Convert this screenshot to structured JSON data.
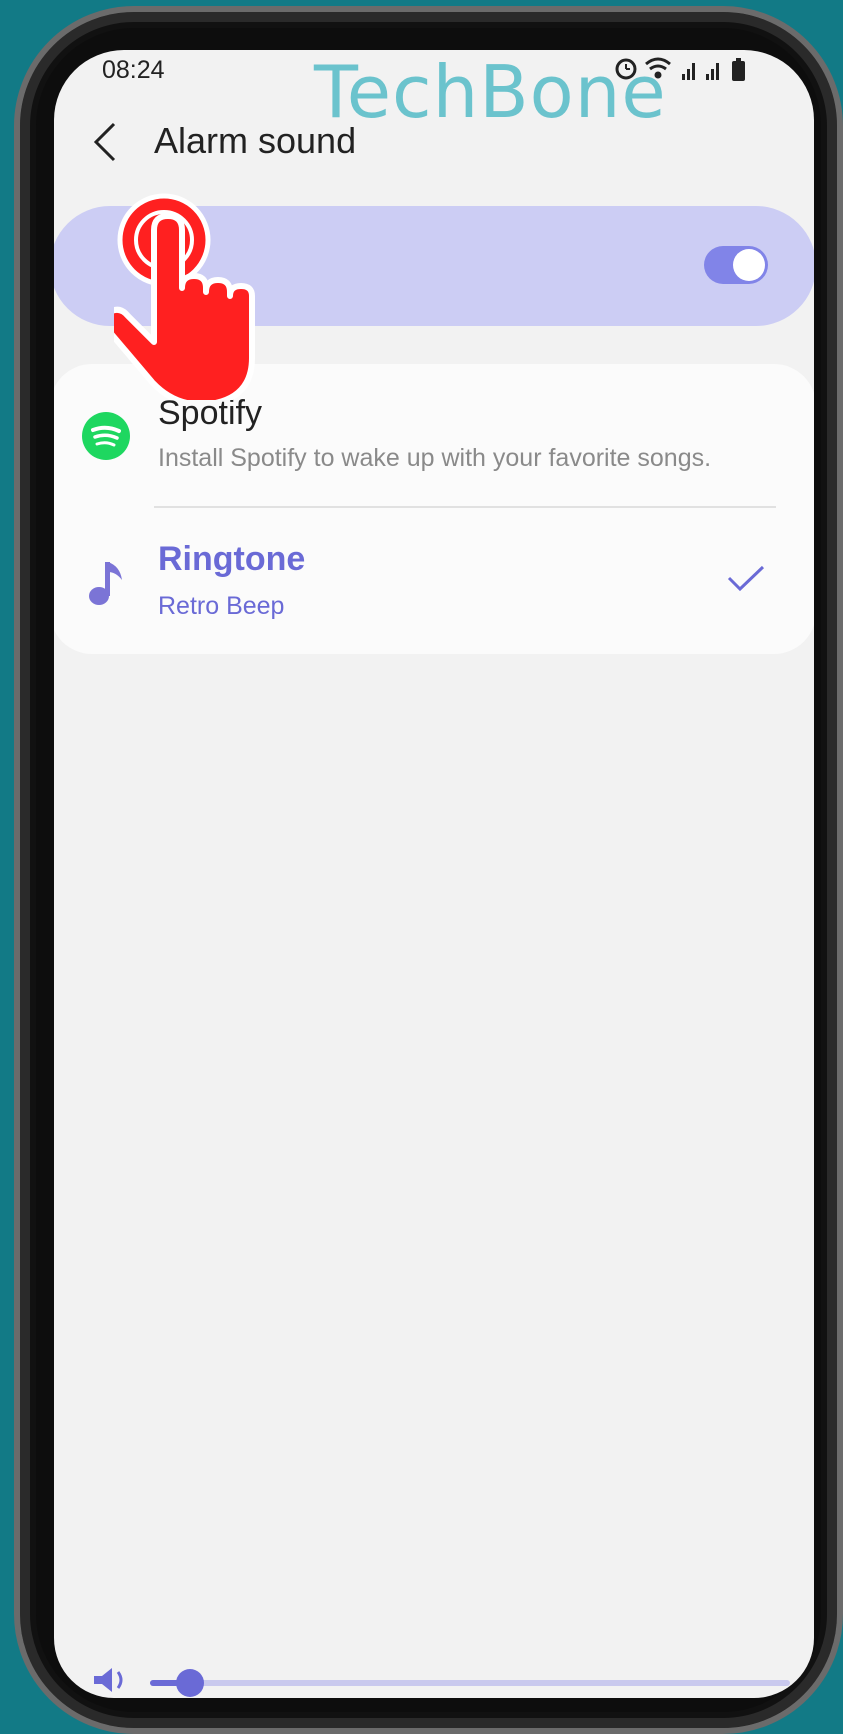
{
  "status_bar": {
    "time": "08:24",
    "icons": [
      "alarm-icon",
      "wifi-icon",
      "signal-icon",
      "signal-icon",
      "battery-icon"
    ]
  },
  "watermark": "TechBone",
  "header": {
    "title": "Alarm sound",
    "back_icon": "back-arrow-icon"
  },
  "master_switch": {
    "state": "on"
  },
  "options": [
    {
      "title": "Spotify",
      "subtitle": "Install Spotify to wake up with your favorite songs.",
      "icon": "spotify-icon",
      "selected": false
    },
    {
      "title": "Ringtone",
      "subtitle": "Retro Beep",
      "icon": "music-note-icon",
      "selected": true
    }
  ],
  "colors": {
    "accent": "#6a6ad6",
    "toggle_on": "#8184e8",
    "highlight_row": "#cccdf4",
    "spotify_green": "#1ed760",
    "teal_background": "#127a86",
    "watermark": "#6bc3cd",
    "tap_indicator": "#ff2020"
  },
  "overlay": {
    "tap_indicator": "tap-hand-icon"
  }
}
